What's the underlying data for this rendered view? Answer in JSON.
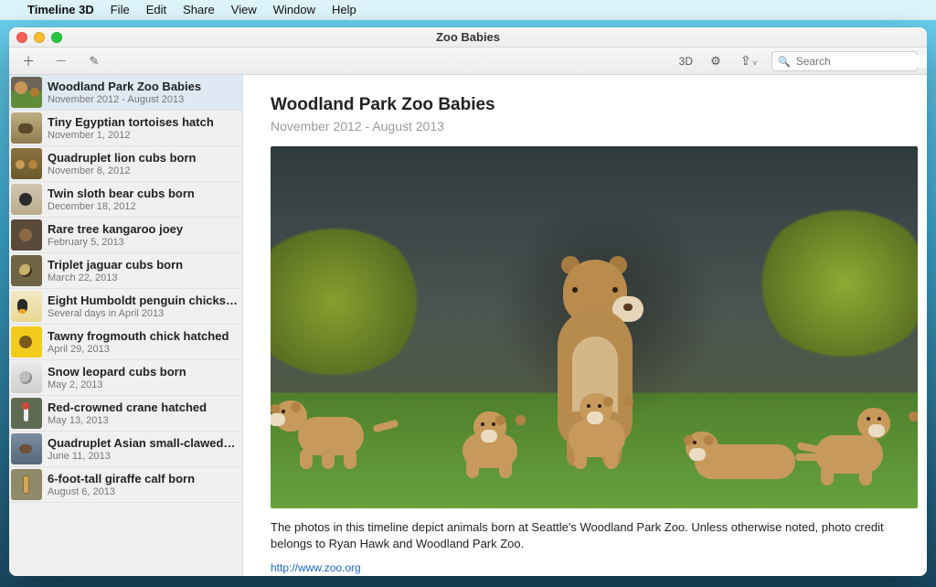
{
  "menubar": {
    "app_name": "Timeline 3D",
    "items": [
      "File",
      "Edit",
      "Share",
      "View",
      "Window",
      "Help"
    ]
  },
  "window": {
    "title": "Zoo Babies"
  },
  "toolbar": {
    "three_d": "3D",
    "search_placeholder": "Search"
  },
  "sidebar": {
    "items": [
      {
        "title": "Woodland Park Zoo Babies",
        "date": "November 2012 - August 2013",
        "thumb": "th-lion",
        "selected": true
      },
      {
        "title": "Tiny Egyptian tortoises hatch",
        "date": "November 1, 2012",
        "thumb": "th-tort"
      },
      {
        "title": "Quadruplet lion cubs born",
        "date": "November 8, 2012",
        "thumb": "th-cubs"
      },
      {
        "title": "Twin sloth bear cubs born",
        "date": "December 18, 2012",
        "thumb": "th-sloth"
      },
      {
        "title": "Rare tree kangaroo joey",
        "date": "February 5, 2013",
        "thumb": "th-kang"
      },
      {
        "title": "Triplet jaguar cubs born",
        "date": "March 22, 2013",
        "thumb": "th-jag"
      },
      {
        "title": "Eight Humboldt penguin chicks hatched",
        "date": "Several days in April 2013",
        "thumb": "th-peng"
      },
      {
        "title": "Tawny frogmouth chick hatched",
        "date": "April 29, 2013",
        "thumb": "th-frog"
      },
      {
        "title": "Snow leopard cubs born",
        "date": "May 2, 2013",
        "thumb": "th-snow"
      },
      {
        "title": "Red-crowned crane hatched",
        "date": "May 13, 2013",
        "thumb": "th-crane"
      },
      {
        "title": "Quadruplet Asian small-clawed otter p…",
        "date": "June 11, 2013",
        "thumb": "th-otter"
      },
      {
        "title": "6-foot-tall giraffe calf born",
        "date": "August 6, 2013",
        "thumb": "th-gir"
      }
    ]
  },
  "detail": {
    "title": "Woodland Park Zoo Babies",
    "subtitle": "November 2012 - August 2013",
    "caption": "The photos in this timeline depict animals born at Seattle's Woodland Park Zoo. Unless otherwise noted, photo credit belongs to Ryan Hawk and Woodland Park Zoo.",
    "link": "http://www.zoo.org"
  }
}
